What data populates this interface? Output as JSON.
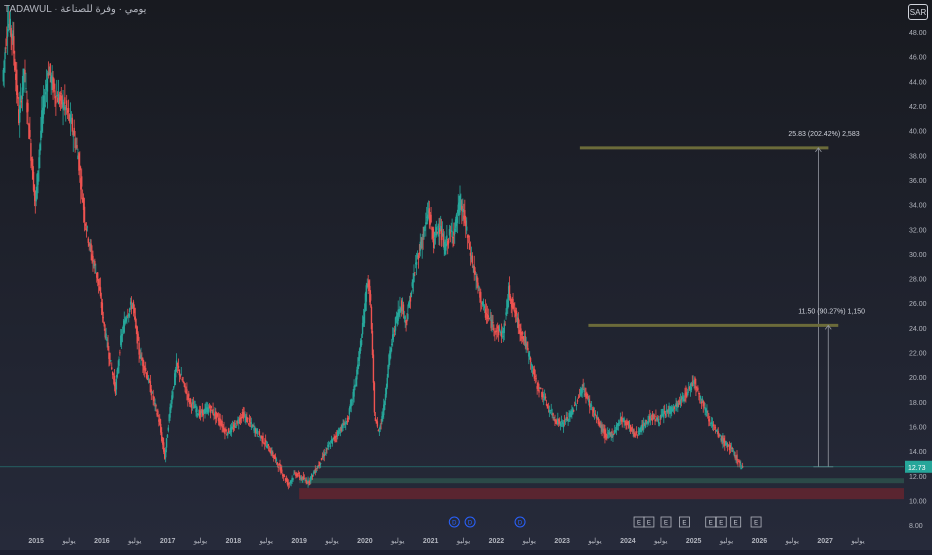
{
  "header": {
    "exchange": "TADAWUL",
    "symbol_text": "يومي · وفرة للصناعة"
  },
  "currency_badge": "SAR",
  "chart_data": {
    "type": "candlestick",
    "x_range": [
      2014.45,
      2028.2
    ],
    "y_range": [
      7.6,
      50.6
    ],
    "y_ticks": [
      "48.00",
      "46.00",
      "44.00",
      "42.00",
      "40.00",
      "38.00",
      "36.00",
      "34.00",
      "32.00",
      "30.00",
      "28.00",
      "26.00",
      "24.00",
      "22.00",
      "20.00",
      "18.00",
      "16.00",
      "14.00",
      "12.00",
      "10.00",
      "8.00"
    ],
    "x_tick_labels": [
      {
        "x": 2015.0,
        "label": "2015"
      },
      {
        "x": 2015.5,
        "label": "يوليو"
      },
      {
        "x": 2016.0,
        "label": "2016"
      },
      {
        "x": 2016.5,
        "label": "يوليو"
      },
      {
        "x": 2017.0,
        "label": "2017"
      },
      {
        "x": 2017.5,
        "label": "يوليو"
      },
      {
        "x": 2018.0,
        "label": "2018"
      },
      {
        "x": 2018.5,
        "label": "يوليو"
      },
      {
        "x": 2019.0,
        "label": "2019"
      },
      {
        "x": 2019.5,
        "label": "يوليو"
      },
      {
        "x": 2020.0,
        "label": "2020"
      },
      {
        "x": 2020.5,
        "label": "يوليو"
      },
      {
        "x": 2021.0,
        "label": "2021"
      },
      {
        "x": 2021.5,
        "label": "يوليو"
      },
      {
        "x": 2022.0,
        "label": "2022"
      },
      {
        "x": 2022.5,
        "label": "يوليو"
      },
      {
        "x": 2023.0,
        "label": "2023"
      },
      {
        "x": 2023.5,
        "label": "يوليو"
      },
      {
        "x": 2024.0,
        "label": "2024"
      },
      {
        "x": 2024.5,
        "label": "يوليو"
      },
      {
        "x": 2025.0,
        "label": "2025"
      },
      {
        "x": 2025.5,
        "label": "يوليو"
      },
      {
        "x": 2026.0,
        "label": "2026"
      },
      {
        "x": 2026.5,
        "label": "يوليو"
      },
      {
        "x": 2027.0,
        "label": "2027"
      },
      {
        "x": 2027.5,
        "label": "يوليو"
      }
    ],
    "last_price": "12.73",
    "last_price_value": 12.73,
    "price_path": [
      [
        2014.5,
        44.0
      ],
      [
        2014.58,
        49.0
      ],
      [
        2014.66,
        47.5
      ],
      [
        2014.75,
        41.0
      ],
      [
        2014.83,
        45.0
      ],
      [
        2014.92,
        39.0
      ],
      [
        2015.0,
        34.0
      ],
      [
        2015.1,
        41.0
      ],
      [
        2015.2,
        45.0
      ],
      [
        2015.3,
        43.0
      ],
      [
        2015.45,
        42.0
      ],
      [
        2015.55,
        40.5
      ],
      [
        2015.65,
        38.0
      ],
      [
        2015.75,
        33.0
      ],
      [
        2015.85,
        30.0
      ],
      [
        2015.95,
        28.0
      ],
      [
        2016.05,
        24.0
      ],
      [
        2016.15,
        21.0
      ],
      [
        2016.22,
        19.0
      ],
      [
        2016.3,
        23.0
      ],
      [
        2016.38,
        25.0
      ],
      [
        2016.48,
        26.0
      ],
      [
        2016.58,
        22.0
      ],
      [
        2016.68,
        20.5
      ],
      [
        2016.78,
        18.5
      ],
      [
        2016.88,
        16.5
      ],
      [
        2016.97,
        13.5
      ],
      [
        2017.05,
        17.5
      ],
      [
        2017.15,
        21.0
      ],
      [
        2017.25,
        19.5
      ],
      [
        2017.35,
        18.0
      ],
      [
        2017.5,
        17.0
      ],
      [
        2017.65,
        17.5
      ],
      [
        2017.8,
        16.5
      ],
      [
        2017.9,
        15.5
      ],
      [
        2018.0,
        15.8
      ],
      [
        2018.15,
        17.0
      ],
      [
        2018.3,
        16.0
      ],
      [
        2018.45,
        15.0
      ],
      [
        2018.6,
        13.8
      ],
      [
        2018.75,
        12.3
      ],
      [
        2018.85,
        11.3
      ],
      [
        2018.95,
        12.2
      ],
      [
        2019.05,
        11.8
      ],
      [
        2019.15,
        11.5
      ],
      [
        2019.3,
        12.8
      ],
      [
        2019.45,
        14.3
      ],
      [
        2019.6,
        15.5
      ],
      [
        2019.75,
        16.5
      ],
      [
        2019.85,
        19.0
      ],
      [
        2019.92,
        21.5
      ],
      [
        2019.98,
        24.0
      ],
      [
        2020.05,
        28.0
      ],
      [
        2020.1,
        26.0
      ],
      [
        2020.16,
        17.0
      ],
      [
        2020.22,
        15.5
      ],
      [
        2020.3,
        17.5
      ],
      [
        2020.38,
        21.5
      ],
      [
        2020.48,
        24.5
      ],
      [
        2020.56,
        26.0
      ],
      [
        2020.64,
        24.5
      ],
      [
        2020.72,
        27.0
      ],
      [
        2020.8,
        29.5
      ],
      [
        2020.9,
        31.5
      ],
      [
        2020.98,
        33.5
      ],
      [
        2021.06,
        31.0
      ],
      [
        2021.14,
        32.5
      ],
      [
        2021.22,
        30.5
      ],
      [
        2021.3,
        31.5
      ],
      [
        2021.38,
        32.0
      ],
      [
        2021.46,
        34.2
      ],
      [
        2021.52,
        33.0
      ],
      [
        2021.62,
        30.0
      ],
      [
        2021.72,
        27.5
      ],
      [
        2021.82,
        25.5
      ],
      [
        2021.92,
        24.5
      ],
      [
        2022.02,
        23.8
      ],
      [
        2022.12,
        23.5
      ],
      [
        2022.2,
        27.0
      ],
      [
        2022.28,
        25.5
      ],
      [
        2022.36,
        24.0
      ],
      [
        2022.44,
        23.0
      ],
      [
        2022.52,
        21.5
      ],
      [
        2022.62,
        19.5
      ],
      [
        2022.72,
        18.5
      ],
      [
        2022.82,
        17.3
      ],
      [
        2022.92,
        16.5
      ],
      [
        2023.02,
        16.2
      ],
      [
        2023.12,
        16.8
      ],
      [
        2023.22,
        17.8
      ],
      [
        2023.32,
        19.2
      ],
      [
        2023.42,
        18.0
      ],
      [
        2023.55,
        16.5
      ],
      [
        2023.68,
        15.2
      ],
      [
        2023.8,
        15.5
      ],
      [
        2023.9,
        16.6
      ],
      [
        2024.0,
        16.3
      ],
      [
        2024.12,
        15.3
      ],
      [
        2024.24,
        16.0
      ],
      [
        2024.36,
        16.8
      ],
      [
        2024.48,
        16.5
      ],
      [
        2024.6,
        17.2
      ],
      [
        2024.72,
        17.5
      ],
      [
        2024.84,
        18.2
      ],
      [
        2024.94,
        19.0
      ],
      [
        2025.02,
        19.8
      ],
      [
        2025.08,
        18.8
      ],
      [
        2025.16,
        17.8
      ],
      [
        2025.26,
        16.5
      ],
      [
        2025.36,
        15.5
      ],
      [
        2025.46,
        14.8
      ],
      [
        2025.56,
        14.3
      ],
      [
        2025.66,
        13.5
      ],
      [
        2025.76,
        12.5
      ]
    ],
    "targets": [
      {
        "level": 38.6,
        "x_start": 2023.27,
        "x_end": 2027.05,
        "label": "25.83 (202.42%) 2,583"
      },
      {
        "level": 24.2,
        "x_start": 2023.4,
        "x_end": 2027.2,
        "label": "11.50 (90.27%) 1,150"
      }
    ],
    "zones": [
      {
        "kind": "support",
        "top": 11.8,
        "bottom": 11.4,
        "x_start": 2019.0,
        "color": "#2b4a48"
      },
      {
        "kind": "demand",
        "top": 11.0,
        "bottom": 10.1,
        "x_start": 2019.0,
        "color": "#5a2530"
      }
    ],
    "events": [
      {
        "x": 2021.36,
        "label": "D",
        "kind": "dividend"
      },
      {
        "x": 2021.6,
        "label": "D",
        "kind": "dividend"
      },
      {
        "x": 2022.36,
        "label": "D",
        "kind": "dividend"
      },
      {
        "x": 2024.17,
        "label": "E",
        "kind": "earnings"
      },
      {
        "x": 2024.32,
        "label": "E",
        "kind": "earnings"
      },
      {
        "x": 2024.58,
        "label": "E",
        "kind": "earnings"
      },
      {
        "x": 2024.86,
        "label": "E",
        "kind": "earnings"
      },
      {
        "x": 2025.26,
        "label": "E",
        "kind": "earnings"
      },
      {
        "x": 2025.42,
        "label": "E",
        "kind": "earnings"
      },
      {
        "x": 2025.64,
        "label": "E",
        "kind": "earnings"
      },
      {
        "x": 2025.95,
        "label": "E",
        "kind": "earnings"
      }
    ],
    "colors": {
      "background": "#1e2130",
      "up": "#26a69a",
      "down": "#ef5350",
      "target_line": "#6b6b3a",
      "last_price_bg": "#26a69a",
      "event_d": "#2962ff",
      "axis_text": "#b2b5be"
    }
  }
}
